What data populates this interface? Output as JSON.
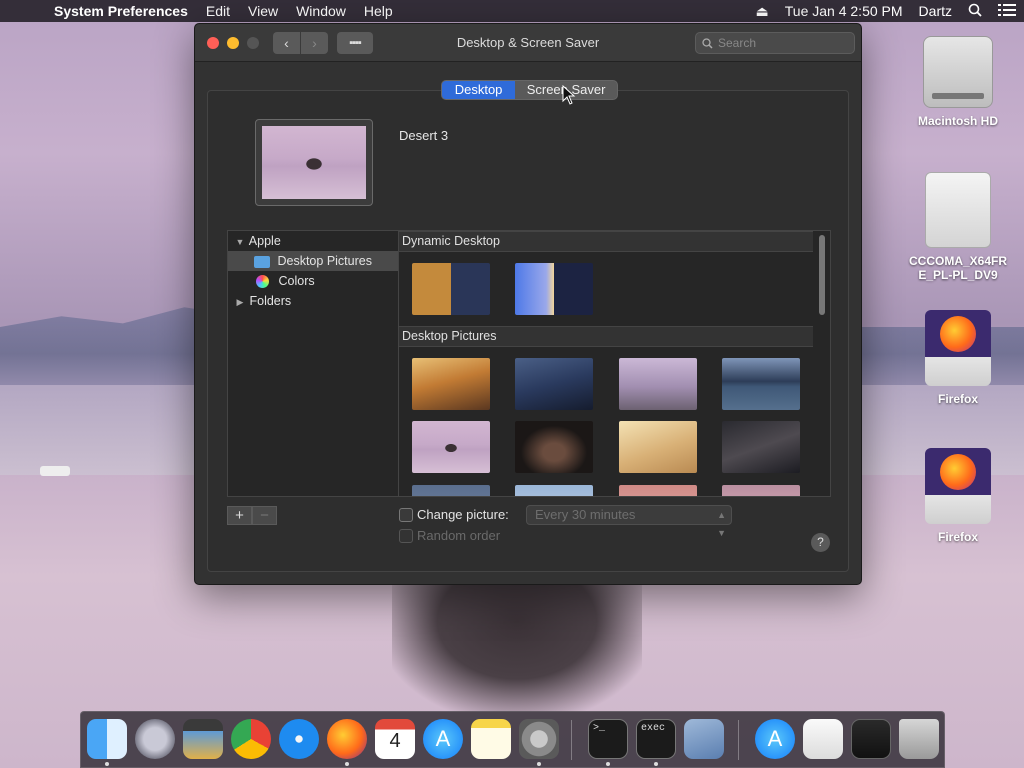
{
  "menubar": {
    "apple_glyph": "",
    "app_name": "System Preferences",
    "menus": [
      "Edit",
      "View",
      "Window",
      "Help"
    ],
    "eject_glyph": "⏏",
    "datetime": "Tue Jan 4  2:50 PM",
    "user": "Dartz"
  },
  "desktop_icons": [
    {
      "label": "Macintosh HD",
      "icon": "hard-drive-icon"
    },
    {
      "label": "CCCOMA_X64FR\nE_PL-PL_DV9",
      "icon": "disk-image-icon"
    },
    {
      "label": "Firefox",
      "icon": "firefox-disk-icon"
    },
    {
      "label": "Firefox",
      "icon": "firefox-disk-icon"
    }
  ],
  "window": {
    "title": "Desktop & Screen Saver",
    "search_placeholder": "Search",
    "tabs": [
      "Desktop",
      "Screen Saver"
    ],
    "selected_tab": "Desktop",
    "current_picture": "Desert 3",
    "sidebar": {
      "group": "Apple",
      "items": [
        "Desktop Pictures",
        "Colors"
      ],
      "selected": "Desktop Pictures",
      "folders": "Folders"
    },
    "sections": [
      "Dynamic Desktop",
      "Desktop Pictures"
    ],
    "change_picture_label": "Change picture:",
    "interval": "Every 30 minutes",
    "random_order_label": "Random order",
    "help": "?"
  },
  "dock": {
    "calendar_month": "JAN",
    "calendar_day": "4",
    "terminal_text": ">_",
    "exec_text": "exec",
    "apps": [
      "Finder",
      "Launchpad",
      "Photo Booth",
      "Chrome",
      "Safari",
      "Firefox",
      "Calendar",
      "App Store",
      "Notes",
      "System Preferences",
      "Terminal",
      "Exec",
      "Preview",
      "App Store",
      "File",
      "Screenshot",
      "Trash"
    ]
  },
  "colors": {
    "accent": "#2f6bd9",
    "window_bg": "#323232"
  }
}
